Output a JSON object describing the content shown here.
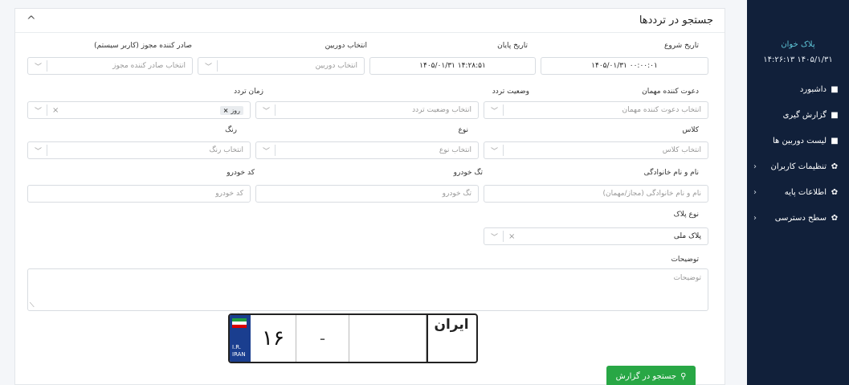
{
  "sidebar": {
    "brand": "پلاک خوان",
    "datetime": "۱۴۰۵/۱/۳۱ ۱۴:۲۶:۱۳",
    "items": [
      {
        "label": "داشبورد",
        "icon": "folder-icon"
      },
      {
        "label": "گزارش گیری",
        "icon": "folder-icon"
      },
      {
        "label": "لیست دوربین ها",
        "icon": "folder-icon"
      },
      {
        "label": "تنظیمات کاربران",
        "icon": "gear-icon",
        "chevron": "‹"
      },
      {
        "label": "اطلاعات پایه",
        "icon": "gear-icon",
        "chevron": "‹"
      },
      {
        "label": "سطح دسترسی",
        "icon": "gear-icon",
        "chevron": "‹"
      }
    ]
  },
  "card": {
    "title": "جستجو در ترددها",
    "collapse_icon": "^"
  },
  "form": {
    "start_date": {
      "label": "تاریخ شروع",
      "value": "۱۴۰۵/۰۱/۳۱ ۰۰:۰۰:۰۱"
    },
    "end_date": {
      "label": "تاریخ پایان",
      "value": "۱۴۰۵/۰۱/۳۱ ۱۴:۲۸:۵۱"
    },
    "camera": {
      "label": "انتخاب دوربین",
      "placeholder": "انتخاب دوربین"
    },
    "issuer": {
      "label": "صادر کننده مجوز (کاربر سیستم)",
      "placeholder": "انتخاب صادر کننده مجوز"
    },
    "inviter": {
      "label": "دعوت کننده مهمان",
      "placeholder": "انتخاب دعوت کننده مهمان"
    },
    "traffic_status": {
      "label": "وضعیت تردد",
      "placeholder": "انتخاب وضعیت تردد"
    },
    "traffic_time": {
      "label": "زمان تردد",
      "chip": "روز"
    },
    "class": {
      "label": "کلاس",
      "placeholder": "انتخاب کلاس"
    },
    "type": {
      "label": "نوع",
      "placeholder": "انتخاب نوع"
    },
    "color": {
      "label": "رنگ",
      "placeholder": "انتخاب رنگ"
    },
    "fullname": {
      "label": "نام و نام خانوادگی",
      "placeholder": "نام و نام خانوادگی (مجاز/مهمان)"
    },
    "car_tag": {
      "label": "تگ خودرو",
      "placeholder": "تگ خودرو"
    },
    "car_code": {
      "label": "کد خودرو",
      "placeholder": "کد خودرو"
    },
    "plate_type": {
      "label": "نوع پلاک",
      "value": "پلاک ملی"
    },
    "notes": {
      "label": "توضیحات",
      "placeholder": "توضیحات"
    }
  },
  "plate": {
    "number": "۱۶",
    "dash": "-",
    "country_code": "I.R.",
    "country": "IRAN",
    "iran_label": "ایران"
  },
  "search_button": {
    "label": "جستجو در گزارش",
    "icon": "search-icon"
  },
  "colors": {
    "sidebar_bg": "#11203a",
    "accent": "#28a745",
    "brand": "#5fc6d8"
  }
}
